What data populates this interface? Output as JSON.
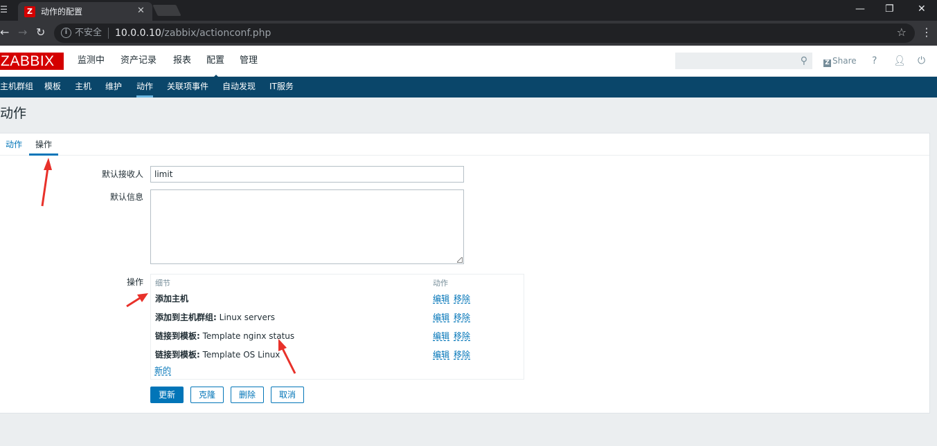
{
  "browser": {
    "tab_title": "动作的配置",
    "tab_favicon": "Z",
    "security_label": "不安全",
    "url_host": "10.0.0.10",
    "url_path": "/zabbix/actionconf.php"
  },
  "header": {
    "logo": "ZABBIX",
    "menu": [
      "监测中",
      "资产记录",
      "报表",
      "配置",
      "管理"
    ],
    "active_menu": "配置",
    "search_placeholder": "",
    "share_label": "Share",
    "help_label": "?"
  },
  "subnav": {
    "items": [
      "主机群组",
      "模板",
      "主机",
      "维护",
      "动作",
      "关联项事件",
      "自动发现",
      "IT服务"
    ],
    "active": "动作"
  },
  "page": {
    "title": "动作",
    "tabs": [
      "动作",
      "操作"
    ],
    "active_tab": "操作"
  },
  "form": {
    "default_recipient_label": "默认接收人",
    "default_recipient_value": "limit",
    "default_message_label": "默认信息",
    "default_message_value": "",
    "operations_label": "操作",
    "operations": {
      "col_details": "细节",
      "col_action": "动作",
      "rows": [
        {
          "bold": "添加主机",
          "text": ""
        },
        {
          "bold": "添加到主机群组:",
          "text": " Linux servers"
        },
        {
          "bold": "链接到模板:",
          "text": " Template nginx status"
        },
        {
          "bold": "链接到模板:",
          "text": " Template OS Linux"
        }
      ],
      "edit_label": "编辑",
      "remove_label": "移除",
      "new_label": "新的"
    },
    "buttons": {
      "update": "更新",
      "clone": "克隆",
      "delete": "删除",
      "cancel": "取消"
    }
  },
  "colors": {
    "brand_red": "#d40000",
    "nav_blue": "#0a466a",
    "link_blue": "#0275b8",
    "annotation_red": "#e8312a"
  }
}
